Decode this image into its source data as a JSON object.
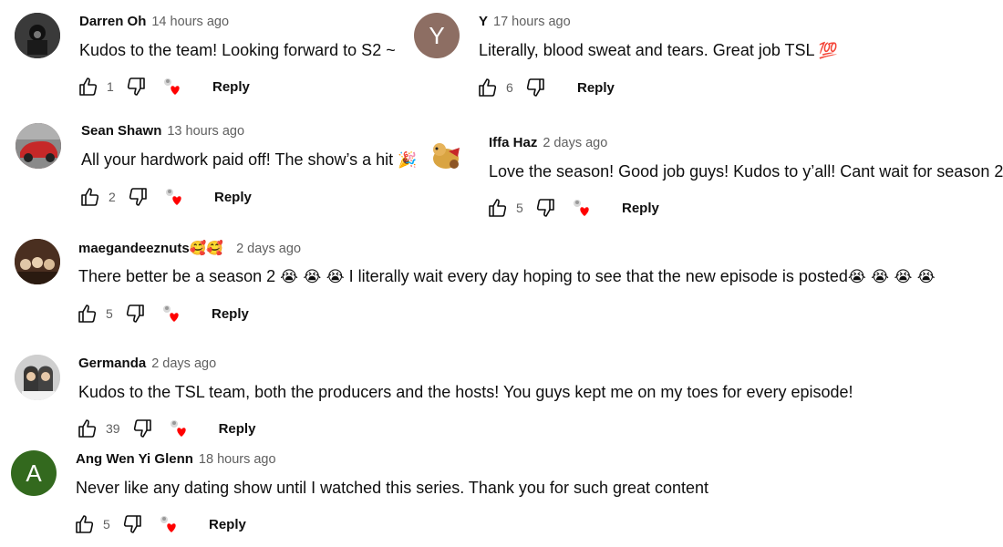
{
  "comments": [
    {
      "author": "Darren Oh",
      "time": "14 hours ago",
      "text": "Kudos to the team! Looking forward to S2 ~",
      "emoji": "",
      "likes": "1",
      "reply": "Reply"
    },
    {
      "author": "Y",
      "time": "17 hours ago",
      "text": "Literally, blood sweat and tears. Great job TSL",
      "emoji": "💯",
      "likes": "6",
      "reply": "Reply",
      "avatar_letter": "Y",
      "avatar_color": "#8d6e63"
    },
    {
      "author": "Sean Shawn",
      "time": "13 hours ago",
      "text": "All your hardwork paid off! The show’s a hit",
      "emoji": "🎉",
      "likes": "2",
      "reply": "Reply"
    },
    {
      "author": "Iffa Haz",
      "time": "2 days ago",
      "text": "Love the season! Good job guys! Kudos to y’all! Cant wait for season 2!!",
      "emoji": "",
      "likes": "5",
      "reply": "Reply"
    },
    {
      "author": "maegandeeznuts",
      "author_emoji": "🥰🥰",
      "time": "2 days ago",
      "text_a": "There better be a season 2",
      "emoji_a": "😭 😭 😭",
      "text_b": "I literally wait every day hoping to see that the new episode is posted",
      "emoji_b": "😭 😭 😭 😭",
      "likes": "5",
      "reply": "Reply"
    },
    {
      "author": "Germanda",
      "time": "2 days ago",
      "text": "Kudos to the TSL team, both the producers and the hosts! You guys kept me on my toes for every episode!",
      "emoji": "",
      "likes": "39",
      "reply": "Reply"
    },
    {
      "author": "Ang Wen Yi Glenn",
      "time": "18 hours ago",
      "text": "Never like any dating show until I watched this series. Thank you for such great content",
      "emoji": "",
      "likes": "5",
      "reply": "Reply",
      "avatar_letter": "A",
      "avatar_color": "#33691e"
    }
  ],
  "icons": {
    "like": "thumbs-up-icon",
    "dislike": "thumbs-down-icon",
    "creator_heart": "creator-heart-icon"
  },
  "colors": {
    "heart": "#ff0000",
    "text": "#0f0f0f",
    "meta": "#606060"
  }
}
